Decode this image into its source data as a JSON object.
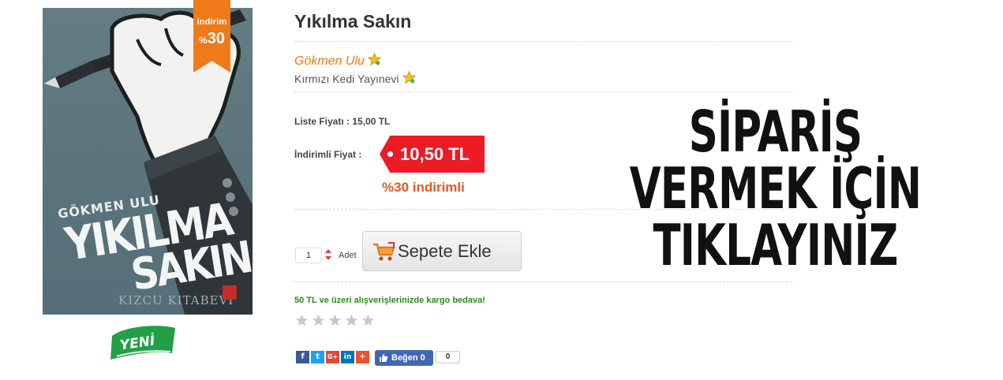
{
  "book": {
    "title": "Yıkılma Sakın",
    "author": "Gökmen Ulu",
    "publisher": "Kırmızı Kedi Yayınevi",
    "cover": {
      "author_text": "GÖKMEN ULU",
      "title_line1": "YIKILMA",
      "title_line2": "SAKIN",
      "publisher_text": "KIZCU KITABEVI"
    },
    "ribbon": {
      "label": "indirim",
      "prefix": "%",
      "value": "30",
      "color": "#f07a1a"
    },
    "new_badge": "YENİ"
  },
  "pricing": {
    "list_price": "Liste Fiyatı : 15,00 TL",
    "sale_label": "İndirimli Fiyat :",
    "sale_price": "10,50 TL",
    "discount_note": "%30 indirimli",
    "tag_color": "#ec1c24"
  },
  "cart": {
    "quantity": "1",
    "unit": "Adet",
    "button_label": "Sepete Ekle"
  },
  "shipping_note": "50 TL ve üzeri alışverişlerinizde kargo bedava!",
  "rating": {
    "stars_filled": 0,
    "stars_total": 5
  },
  "social": {
    "share_icons": [
      "facebook-icon",
      "twitter-icon",
      "google-plus-icon",
      "linkedin-icon",
      "plus-icon"
    ],
    "like_label": "Beğen 0",
    "like_count": "0"
  },
  "cta": {
    "line1": "SİPARİŞ",
    "line2": "VERMEK İÇİN",
    "line3": "TIKLAYINIZ"
  }
}
